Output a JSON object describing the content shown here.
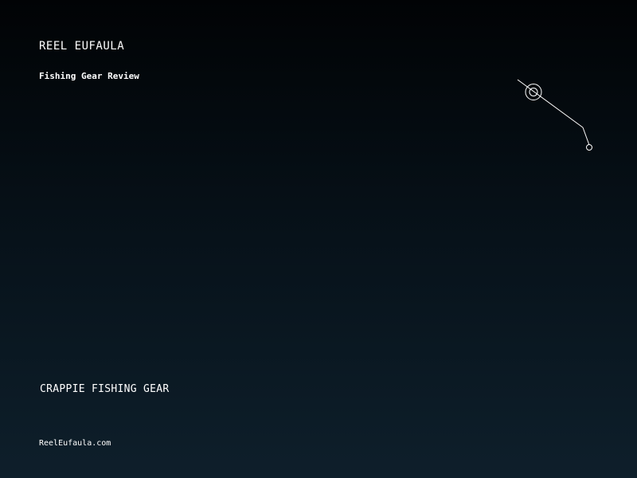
{
  "brand": {
    "name": "REEL EUFAULA",
    "subtitle": "Fishing Gear Review"
  },
  "logo": {
    "icon": "fishing-rod-reel-icon",
    "color": "#ffffff"
  },
  "headline": "CRAPPIE FISHING GEAR",
  "footer": {
    "url": "ReelEufaula.com"
  },
  "colors": {
    "background_top": "#010305",
    "background_bottom": "#0e1f2b",
    "text": "#ffffff"
  }
}
